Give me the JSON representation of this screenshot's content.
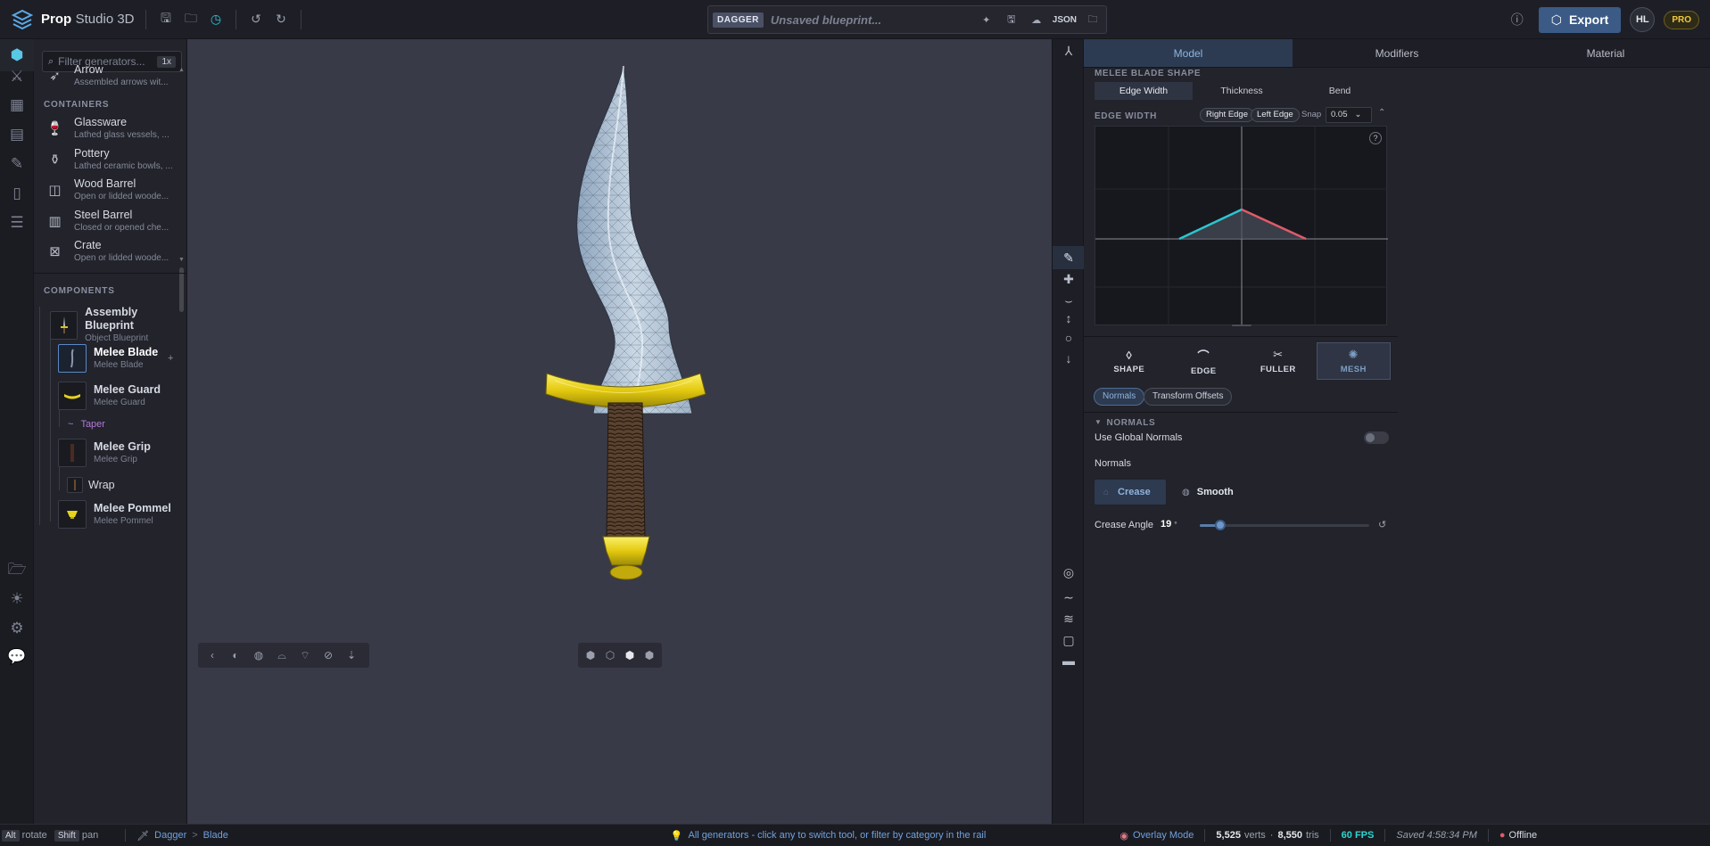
{
  "app": {
    "brand_bold": "Prop",
    "brand_rest": "Studio 3D"
  },
  "blueprint": {
    "tag": "DAGGER",
    "placeholder": "Unsaved blueprint...",
    "json_label": "JSON"
  },
  "header": {
    "export_label": "Export",
    "avatar_initials": "HL",
    "plan_badge": "PRO"
  },
  "generators": {
    "filter_placeholder": "Filter generators...",
    "filter_badge": "1x",
    "top_item": {
      "name": "Arrow",
      "desc": "Assembled arrows wit..."
    },
    "section_containers": "CONTAINERS",
    "items": [
      {
        "name": "Glassware",
        "desc": "Lathed glass vessels, ..."
      },
      {
        "name": "Pottery",
        "desc": "Lathed ceramic bowls, ..."
      },
      {
        "name": "Wood Barrel",
        "desc": "Open or lidded woode..."
      },
      {
        "name": "Steel Barrel",
        "desc": "Closed or opened che..."
      },
      {
        "name": "Crate",
        "desc": "Open or lidded woode..."
      }
    ]
  },
  "components": {
    "section_label": "COMPONENTS",
    "root": {
      "name": "Assembly Blueprint",
      "sub": "Object Blueprint"
    },
    "blade": {
      "name": "Melee Blade",
      "sub": "Melee Blade",
      "add": "+"
    },
    "guard": {
      "name": "Melee Guard",
      "sub": "Melee Guard"
    },
    "taper": {
      "name": "Taper",
      "glyph": "~"
    },
    "grip": {
      "name": "Melee Grip",
      "sub": "Melee Grip"
    },
    "wrap": {
      "name": "Wrap"
    },
    "pommel": {
      "name": "Melee Pommel",
      "sub": "Melee Pommel"
    }
  },
  "props": {
    "tabs": [
      "Model",
      "Modifiers",
      "Material"
    ],
    "blade_shape_label": "MELEE BLADE SHAPE",
    "shape_segments": [
      "Edge Width",
      "Thickness",
      "Bend"
    ],
    "edge_width_label": "EDGE WIDTH",
    "chip_right": "Right Edge",
    "chip_left": "Left Edge",
    "chip_snap": "Snap",
    "snap_value": "0.05",
    "help": "?",
    "mode_tabs": [
      "SHAPE",
      "EDGE",
      "FULLER",
      "MESH"
    ],
    "sub_pills": [
      "Normals",
      "Transform Offsets"
    ],
    "normals_section": "NORMALS",
    "use_global_normals": "Use Global Normals",
    "normals_label": "Normals",
    "crease_label": "Crease",
    "smooth_label": "Smooth",
    "crease_angle_label": "Crease Angle",
    "crease_angle_value": "19",
    "crease_angle_unit": "°",
    "crease_angle_fraction": 0.12
  },
  "status": {
    "alt_key": "Alt",
    "alt_action": "rotate",
    "shift_key": "Shift",
    "shift_action": "pan",
    "crumb_1": "Dagger",
    "crumb_sep": ">",
    "crumb_2": "Blade",
    "hint": "All generators - click any to switch tool, or filter by category in the rail",
    "overlay": "Overlay Mode",
    "verts_value": "5,525",
    "verts_label": "verts",
    "dot": "·",
    "tris_value": "8,550",
    "tris_label": "tris",
    "fps": "60 FPS",
    "saved": "Saved 4:58:34 PM",
    "offline": "Offline"
  },
  "colors": {
    "accent": "#2fc3d8",
    "export": "#3b5b86",
    "pro": "#f1c83a",
    "right_edge_line": "#2cc6d0",
    "left_edge_line": "#e05a6a",
    "guard_gold": "#e7d31e"
  }
}
